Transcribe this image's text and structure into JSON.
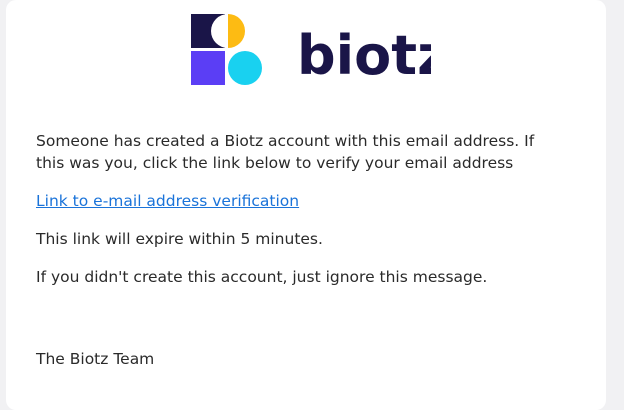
{
  "logo": {
    "wordmark": "biotz",
    "colors": {
      "navy": "#1a1548",
      "yellow": "#fdbb13",
      "purple": "#5b3ef5",
      "cyan": "#19d1f0"
    }
  },
  "email": {
    "intro": "Someone has created a Biotz account with this email address. If this was you, click the link below to verify your email address",
    "link_label": "Link to e-mail address verification",
    "expiry_note": "This link will expire within 5 minutes.",
    "ignore_note": "If you didn't create this account, just ignore this message.",
    "signature": "The Biotz Team"
  },
  "colors": {
    "link": "#1a73d9",
    "text": "#2a2a2a"
  }
}
